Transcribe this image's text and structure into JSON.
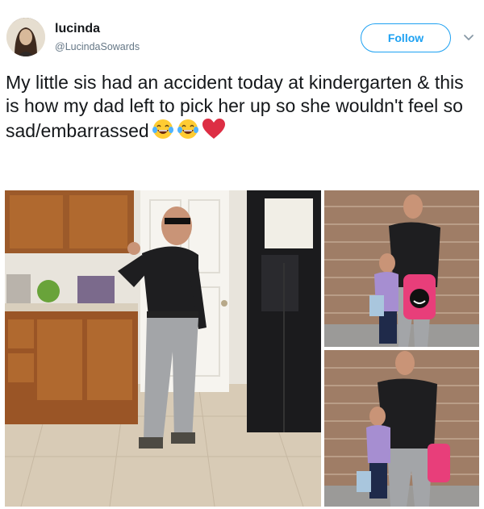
{
  "user": {
    "name": "lucinda",
    "handle": "@LucindaSowards"
  },
  "follow_button": {
    "label": "Follow"
  },
  "tweet": {
    "text": "My little sis had an accident today at kindergarten & this is how my dad left to pick her up so she wouldn't feel so sad/embarrassed",
    "emojis": [
      "tears-of-joy-emoji",
      "tears-of-joy-emoji",
      "red-heart-emoji"
    ]
  },
  "colors": {
    "accent": "#1da1f2",
    "text": "#14171a",
    "secondary_text": "#657786"
  },
  "photos": [
    {
      "name": "kitchen-photo"
    },
    {
      "name": "brick-wall-photo-top"
    },
    {
      "name": "brick-wall-photo-bottom"
    }
  ]
}
